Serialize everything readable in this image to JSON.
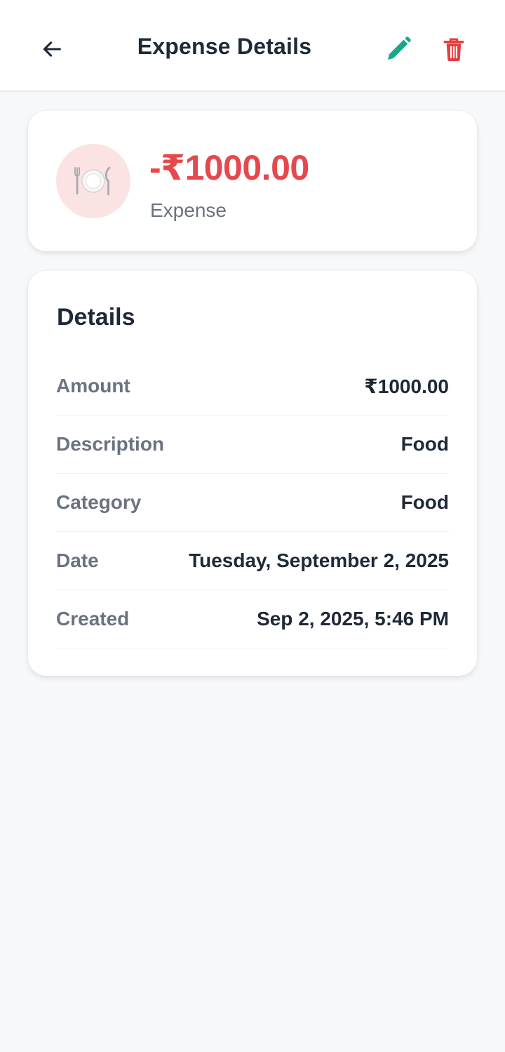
{
  "header": {
    "title": "Expense Details",
    "back_icon": "arrow-left-icon",
    "edit_icon": "pencil-icon",
    "delete_icon": "trash-icon"
  },
  "summary": {
    "category_icon": "plate-cutlery-icon",
    "amount": "-₹1000.00",
    "type": "Expense"
  },
  "details": {
    "heading": "Details",
    "rows": [
      {
        "label": "Amount",
        "value": "₹1000.00"
      },
      {
        "label": "Description",
        "value": "Food"
      },
      {
        "label": "Category",
        "value": "Food"
      },
      {
        "label": "Date",
        "value": "Tuesday, September 2, 2025"
      },
      {
        "label": "Created",
        "value": "Sep 2, 2025, 5:46 PM"
      }
    ]
  },
  "colors": {
    "expense_red": "#e5484d",
    "edit_teal": "#17a98e",
    "delete_red": "#e53e3e",
    "icon_circle_bg": "#fbe3e3",
    "page_bg": "#f7f8fa"
  }
}
